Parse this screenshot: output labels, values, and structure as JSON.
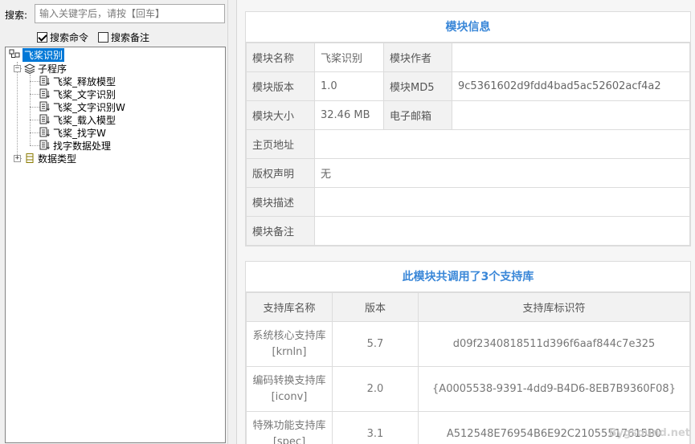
{
  "search": {
    "label": "搜索:",
    "placeholder": "输入关键字后，请按【回车】",
    "value": ""
  },
  "options": [
    {
      "label": "搜索命令",
      "checked": true
    },
    {
      "label": "搜索备注",
      "checked": false
    }
  ],
  "tree": {
    "root": "飞桨识别",
    "group_subs": "子程序",
    "subs": [
      "飞桨_释放模型",
      "飞桨_文字识别",
      "飞桨_文字识别W",
      "飞桨_载入模型",
      "飞桨_找字W",
      "找字数据处理"
    ],
    "group_types": "数据类型"
  },
  "module_info": {
    "title": "模块信息",
    "name_label": "模块名称",
    "name_value": "飞桨识别",
    "author_label": "模块作者",
    "author_value": "",
    "version_label": "模块版本",
    "version_value": "1.0",
    "md5_label": "模块MD5",
    "md5_value": "9c5361602d9fdd4bad5ac52602acf4a2",
    "size_label": "模块大小",
    "size_value": "32.46 MB",
    "email_label": "电子邮箱",
    "email_value": "",
    "home_label": "主页地址",
    "home_value": "",
    "copyright_label": "版权声明",
    "copyright_value": "无",
    "desc_label": "模块描述",
    "desc_value": "",
    "note_label": "模块备注",
    "note_value": ""
  },
  "libs": {
    "title": "此模块共调用了3个支持库",
    "headers": [
      "支持库名称",
      "版本",
      "支持库标识符"
    ],
    "rows": [
      {
        "name": "系统核心支持库",
        "code": "[krnln]",
        "version": "5.7",
        "id": "d09f2340818511d396f6aaf844c7e325"
      },
      {
        "name": "编码转换支持库",
        "code": "[iconv]",
        "version": "2.0",
        "id": "{A0005538-9391-4dd9-B4D6-8EB7B9360F08}"
      },
      {
        "name": "特殊功能支持库",
        "code": "[spec]",
        "version": "3.1",
        "id": "A512548E76954B6E92C21055517615B0"
      }
    ]
  },
  "watermark": "Bygsound.net",
  "colors": {
    "accent": "#3a87d8",
    "selection": "#0078d7"
  }
}
